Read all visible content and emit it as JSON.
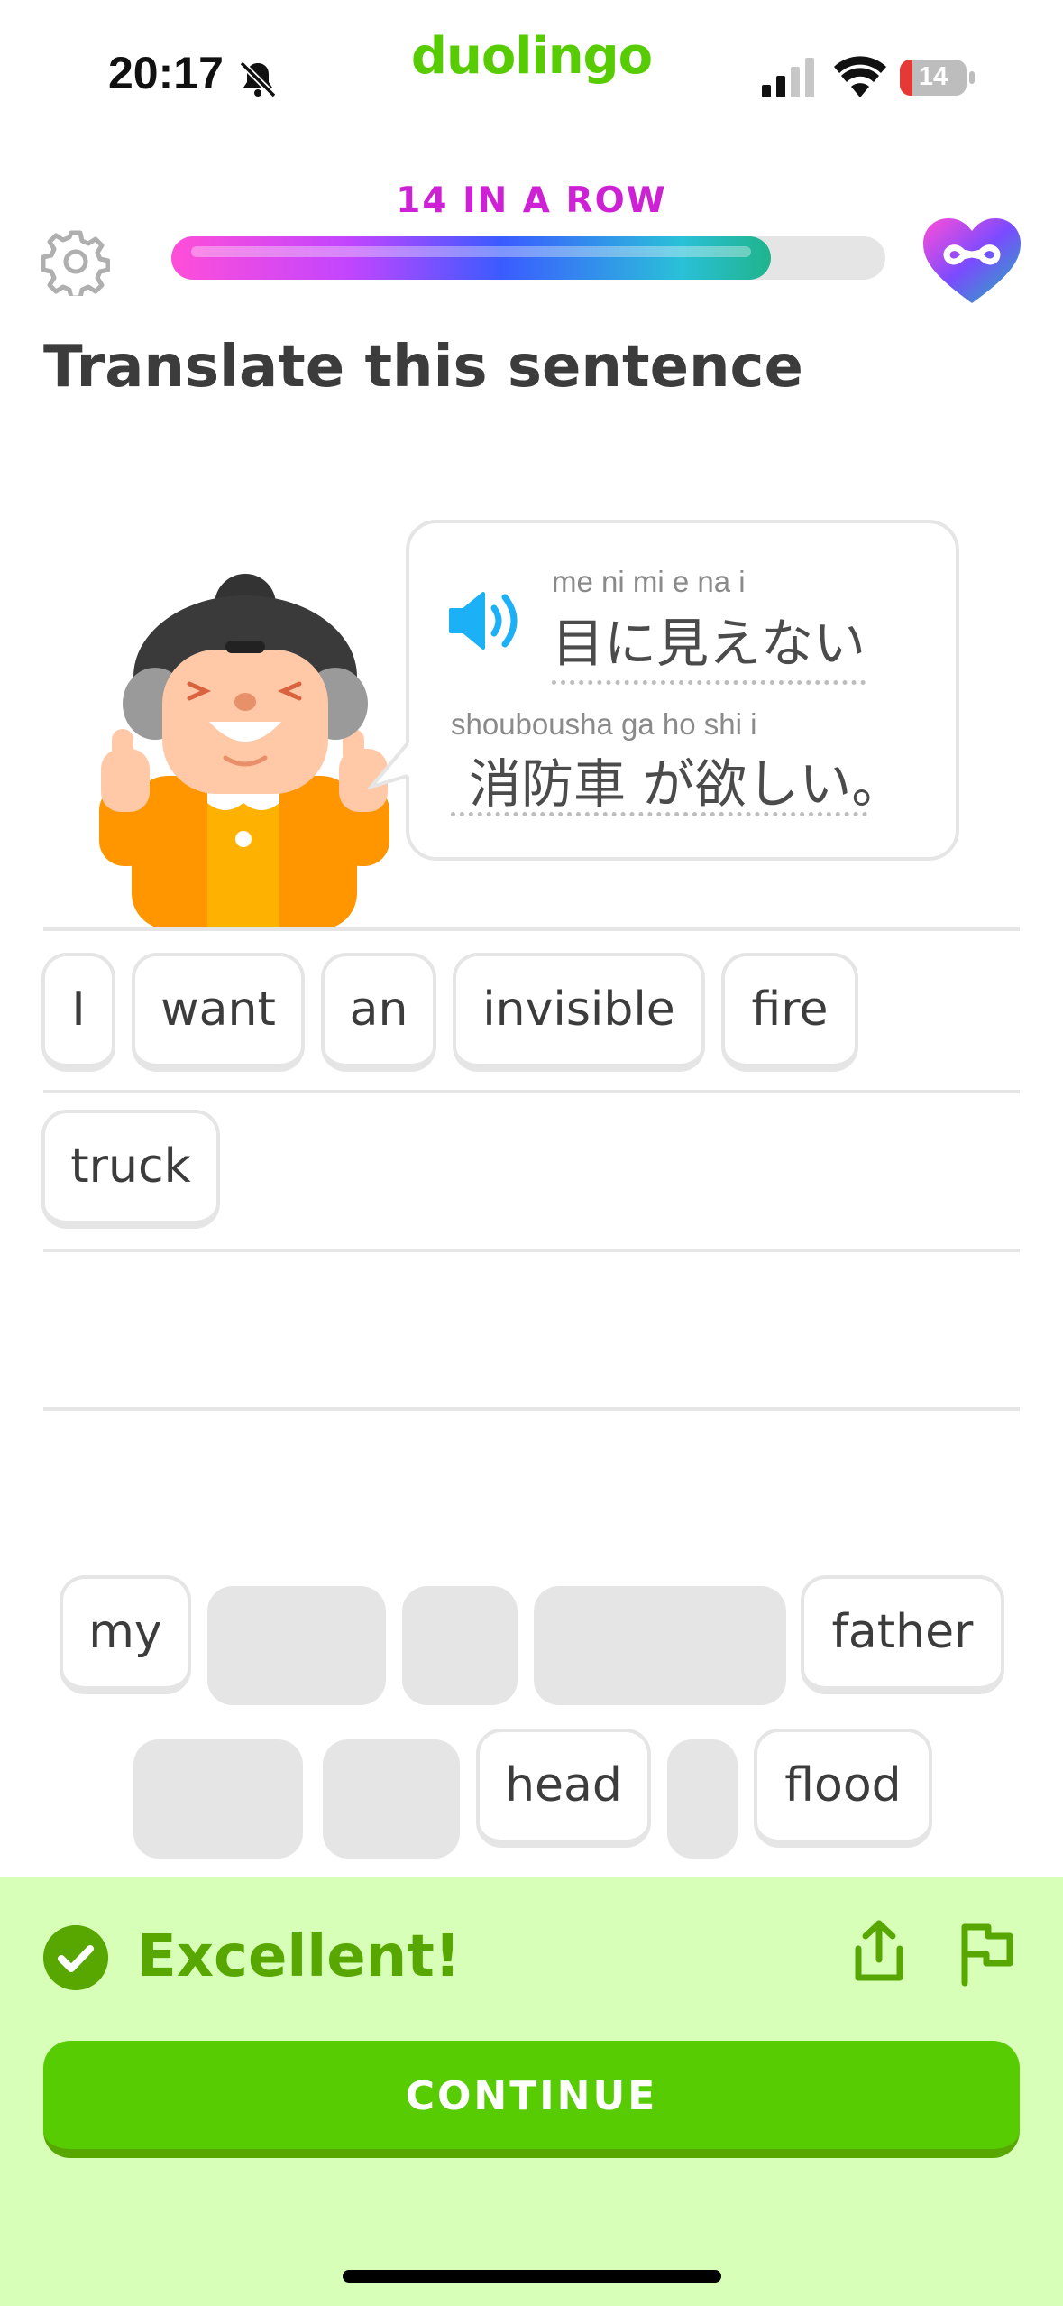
{
  "status_bar": {
    "time": "20:17",
    "battery_level": "14",
    "icons": [
      "bell-slash-icon",
      "signal-icon",
      "wifi-icon",
      "battery-icon"
    ]
  },
  "app": {
    "brand": "duolingo"
  },
  "progress": {
    "streak_label": "14 IN A ROW",
    "fraction": 0.84,
    "hearts": "∞"
  },
  "exercise": {
    "instruction": "Translate this sentence",
    "line1": {
      "furigana": "me ni mi e na  i",
      "text": "目に見えない"
    },
    "line2": {
      "furigana": "shoubousha ga ho shi  i",
      "text": "消防車 が欲しい。"
    }
  },
  "answer": {
    "words": [
      "I",
      "want",
      "an",
      "invisible",
      "fire",
      "truck"
    ]
  },
  "word_bank": {
    "row1": [
      "my",
      "",
      "",
      "",
      "father"
    ],
    "row2": [
      "",
      "",
      "head",
      "",
      "flood"
    ]
  },
  "feedback": {
    "message": "Excellent!",
    "continue_label": "CONTINUE"
  },
  "colors": {
    "brand_green": "#58cc02",
    "dark_green": "#58a700",
    "feedback_bg": "#d7ffb8",
    "streak_magenta": "#ce21d6",
    "speaker_blue": "#1cb0f6"
  }
}
